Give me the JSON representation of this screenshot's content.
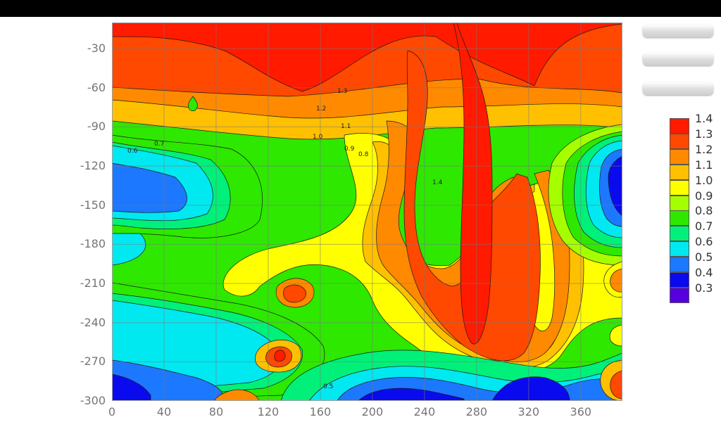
{
  "chart_data": {
    "type": "heatmap",
    "subtype": "filled-contour",
    "xlim": [
      0,
      392
    ],
    "ylim": [
      -300,
      -10
    ],
    "x_ticks": [
      "0",
      "40",
      "80",
      "120",
      "160",
      "200",
      "240",
      "280",
      "320",
      "360"
    ],
    "y_ticks": [
      "-30",
      "-60",
      "-90",
      "-120",
      "-150",
      "-180",
      "-210",
      "-240",
      "-270",
      "-300"
    ],
    "grid": true,
    "colorbar": {
      "position": "right",
      "levels": [
        "1.4",
        "1.3",
        "1.2",
        "1.1",
        "1.0",
        "0.9",
        "0.8",
        "0.7",
        "0.6",
        "0.5",
        "0.4",
        "0.3"
      ],
      "colors": [
        "#ff1a00",
        "#ff4800",
        "#ff8a00",
        "#ffc000",
        "#ffff00",
        "#a6ff00",
        "#2ee800",
        "#00f07a",
        "#00e8f0",
        "#1c78ff",
        "#0a0aee",
        "#5500dd"
      ]
    },
    "contour_labels": [
      "1.4",
      "1.3",
      "1.2",
      "1.1",
      "1.0",
      "0.9",
      "0.8",
      "0.7",
      "0.6",
      "0.5"
    ]
  },
  "side_buttons": [
    "",
    "",
    ""
  ]
}
